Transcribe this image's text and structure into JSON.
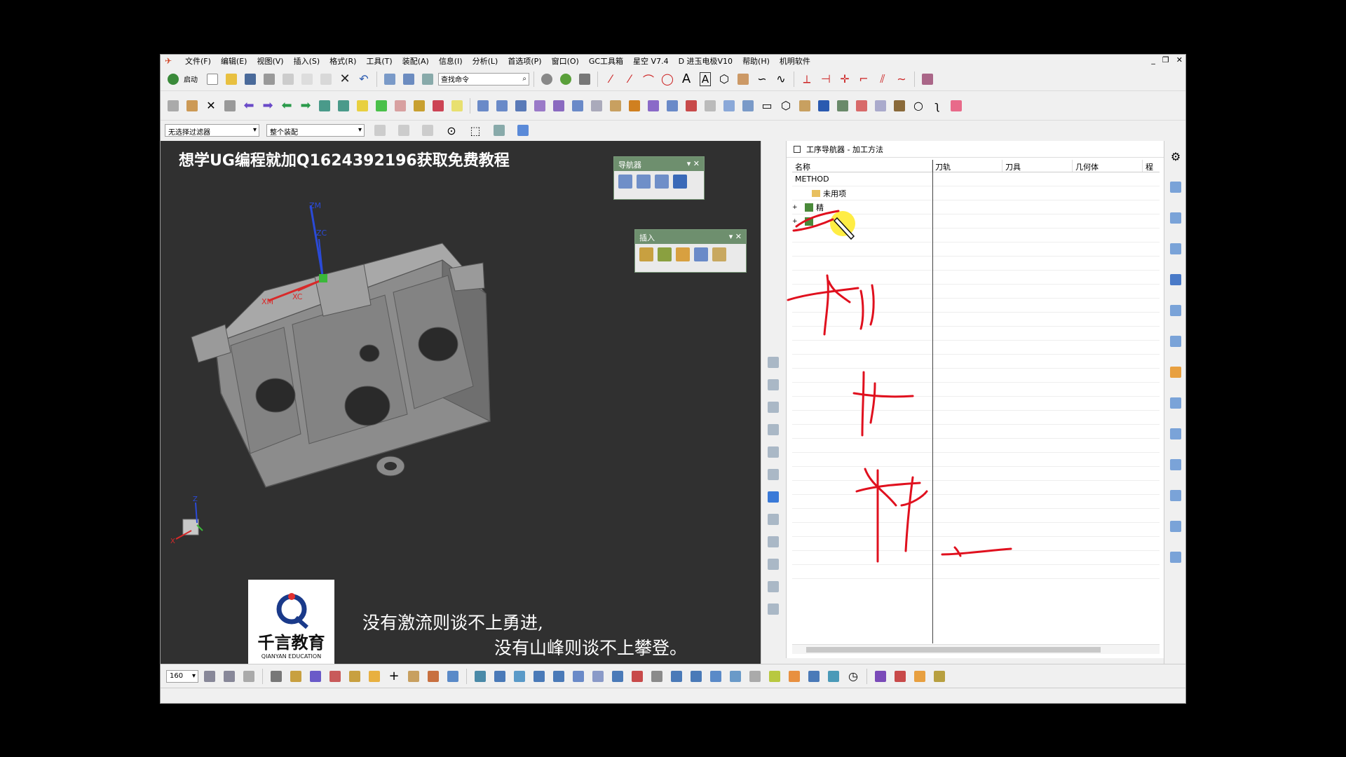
{
  "app": {
    "menu": [
      "文件(F)",
      "编辑(E)",
      "视图(V)",
      "插入(S)",
      "格式(R)",
      "工具(T)",
      "装配(A)",
      "信息(I)",
      "分析(L)",
      "首选项(P)",
      "窗口(O)",
      "GC工具箱",
      "星空 V7.4",
      "D 进玉电极V10",
      "帮助(H)",
      "机明软件"
    ],
    "window_controls": [
      "_",
      "❐",
      "✕"
    ]
  },
  "toolbar": {
    "start_label": "启动",
    "search_placeholder": "查找命令",
    "selection_filter": "无选择过滤器",
    "assembly_scope": "整个装配"
  },
  "viewport": {
    "ad_text": "想学UG编程就加Q1624392196获取免费教程",
    "axes": {
      "zm": "ZM",
      "zc": "ZC",
      "xm": "XM",
      "xc": "XC",
      "z": "Z",
      "x": "X"
    },
    "navigator_panel": {
      "title": "导航器"
    },
    "insert_panel": {
      "title": "插入"
    },
    "logo_text": "千言教育",
    "logo_sub": "QIANYAN EDUCATION",
    "slogan_line1": "没有激流则谈不上勇进,",
    "slogan_line2": "没有山峰则谈不上攀登。"
  },
  "navigator": {
    "title": "工序导航器 - 加工方法",
    "columns": [
      "名称",
      "刀轨",
      "刀具",
      "几何体",
      "程"
    ],
    "root": "METHOD",
    "items": [
      "未用项",
      "精"
    ]
  },
  "bottom": {
    "zoom": "160"
  },
  "colors": {
    "viewport_bg": "#303030",
    "panel_header": "#6e8f6e",
    "annotation_red": "#e0101e",
    "highlight_yellow": "#ffec3a"
  }
}
